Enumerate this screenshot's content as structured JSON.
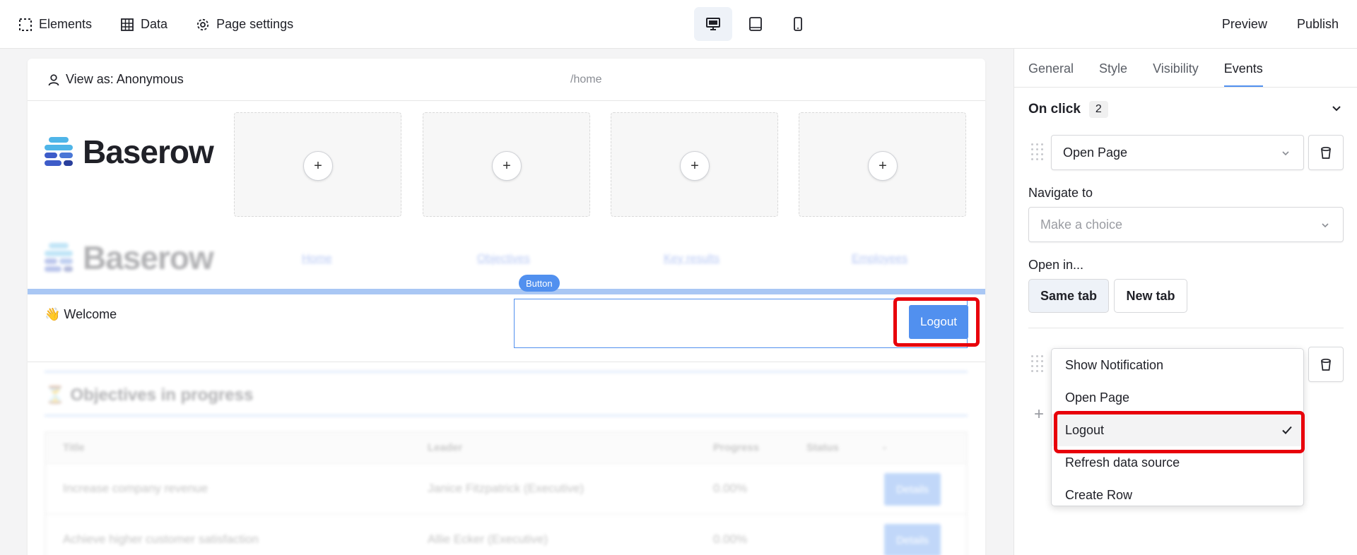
{
  "topbar": {
    "elements": "Elements",
    "data": "Data",
    "page_settings": "Page settings",
    "preview": "Preview",
    "publish": "Publish"
  },
  "page": {
    "view_as": "View as: Anonymous",
    "path": "/home",
    "logo_text": "Baserow",
    "nav_links": [
      "Home",
      "Objectives",
      "Key results",
      "Employees"
    ],
    "selected_tag": "Button",
    "welcome": "👋 Welcome",
    "logout_button": "Logout",
    "objectives_title": "⏳ Objectives in progress",
    "table": {
      "headers": [
        "Title",
        "Leader",
        "Progress",
        "Status",
        "-"
      ],
      "rows": [
        [
          "Increase company revenue",
          "Janice Fitzpatrick (Executive)",
          "0.00%",
          "",
          "Details"
        ],
        [
          "Achieve higher customer satisfaction",
          "Allie Ecker (Executive)",
          "0.00%",
          "",
          "Details"
        ]
      ]
    }
  },
  "panel": {
    "tabs": [
      "General",
      "Style",
      "Visibility",
      "Events"
    ],
    "active_tab": "Events",
    "event_title": "On click",
    "event_count": "2",
    "action1_value": "Open Page",
    "navigate_label": "Navigate to",
    "navigate_placeholder": "Make a choice",
    "open_in_label": "Open in...",
    "same_tab": "Same tab",
    "new_tab": "New tab",
    "dropdown_options": [
      "Show Notification",
      "Open Page",
      "Logout",
      "Refresh data source",
      "Create Row"
    ],
    "dropdown_selected": "Logout"
  },
  "colors": {
    "accent": "#5190ef",
    "highlight": "#e8000b"
  }
}
